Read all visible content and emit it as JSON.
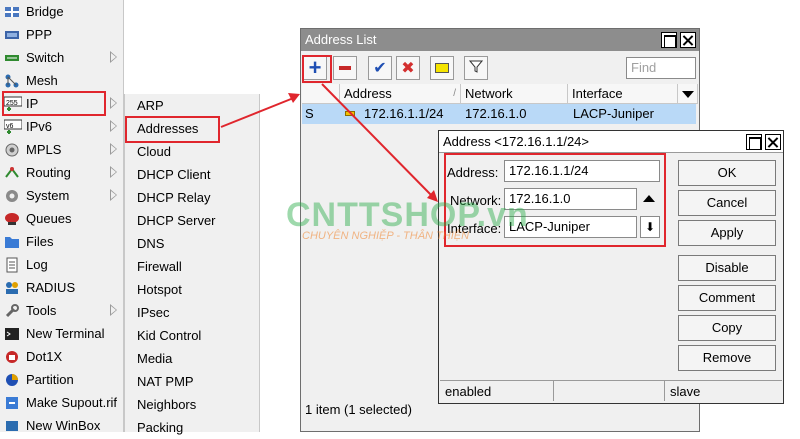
{
  "main_menu": {
    "items": [
      {
        "label": "Bridge",
        "icon": "bridge-icon",
        "arrow": false
      },
      {
        "label": "PPP",
        "icon": "ppp-icon",
        "arrow": false
      },
      {
        "label": "Switch",
        "icon": "switch-icon",
        "arrow": true
      },
      {
        "label": "Mesh",
        "icon": "mesh-icon",
        "arrow": false
      },
      {
        "label": "IP",
        "icon": "ip-icon",
        "arrow": true
      },
      {
        "label": "IPv6",
        "icon": "ipv6-icon",
        "arrow": true
      },
      {
        "label": "MPLS",
        "icon": "mpls-icon",
        "arrow": true
      },
      {
        "label": "Routing",
        "icon": "routing-icon",
        "arrow": true
      },
      {
        "label": "System",
        "icon": "system-icon",
        "arrow": true
      },
      {
        "label": "Queues",
        "icon": "queues-icon",
        "arrow": false
      },
      {
        "label": "Files",
        "icon": "files-icon",
        "arrow": false
      },
      {
        "label": "Log",
        "icon": "log-icon",
        "arrow": false
      },
      {
        "label": "RADIUS",
        "icon": "radius-icon",
        "arrow": false
      },
      {
        "label": "Tools",
        "icon": "tools-icon",
        "arrow": true
      },
      {
        "label": "New Terminal",
        "icon": "terminal-icon",
        "arrow": false
      },
      {
        "label": "Dot1X",
        "icon": "dot1x-icon",
        "arrow": false
      },
      {
        "label": "Partition",
        "icon": "partition-icon",
        "arrow": false
      },
      {
        "label": "Make Supout.rif",
        "icon": "supout-icon",
        "arrow": false
      },
      {
        "label": "New WinBox",
        "icon": "winbox-icon",
        "arrow": false
      }
    ]
  },
  "ip_submenu": {
    "items": [
      "ARP",
      "Addresses",
      "Cloud",
      "DHCP Client",
      "DHCP Relay",
      "DHCP Server",
      "DNS",
      "Firewall",
      "Hotspot",
      "IPsec",
      "Kid Control",
      "Media",
      "NAT PMP",
      "Neighbors",
      "Packing"
    ]
  },
  "address_list": {
    "title": "Address List",
    "find_placeholder": "Find",
    "columns": [
      "Address",
      "Network",
      "Interface"
    ],
    "rows": [
      {
        "flag": "S",
        "address": "172.16.1.1/24",
        "network": "172.16.1.0",
        "interface": "LACP-Juniper"
      }
    ],
    "status": "1 item (1 selected)"
  },
  "address_dialog": {
    "title": "Address <172.16.1.1/24>",
    "address_label": "Address:",
    "address_value": "172.16.1.1/24",
    "network_label": "Network:",
    "network_value": "172.16.1.0",
    "interface_label": "Interface:",
    "interface_value": "LACP-Juniper",
    "buttons": [
      "OK",
      "Cancel",
      "Apply",
      "Disable",
      "Comment",
      "Copy",
      "Remove"
    ],
    "status_left": "enabled",
    "status_right": "slave"
  },
  "watermark": {
    "main": "CNTTSHOP.vn",
    "sub": "CHUYÊN NGHIỆP - THÂN THIỆN"
  },
  "colors": {
    "highlight_red": "#e0262d",
    "selected_row": "#b9d9f7",
    "add_blue": "#1f4fb3"
  }
}
